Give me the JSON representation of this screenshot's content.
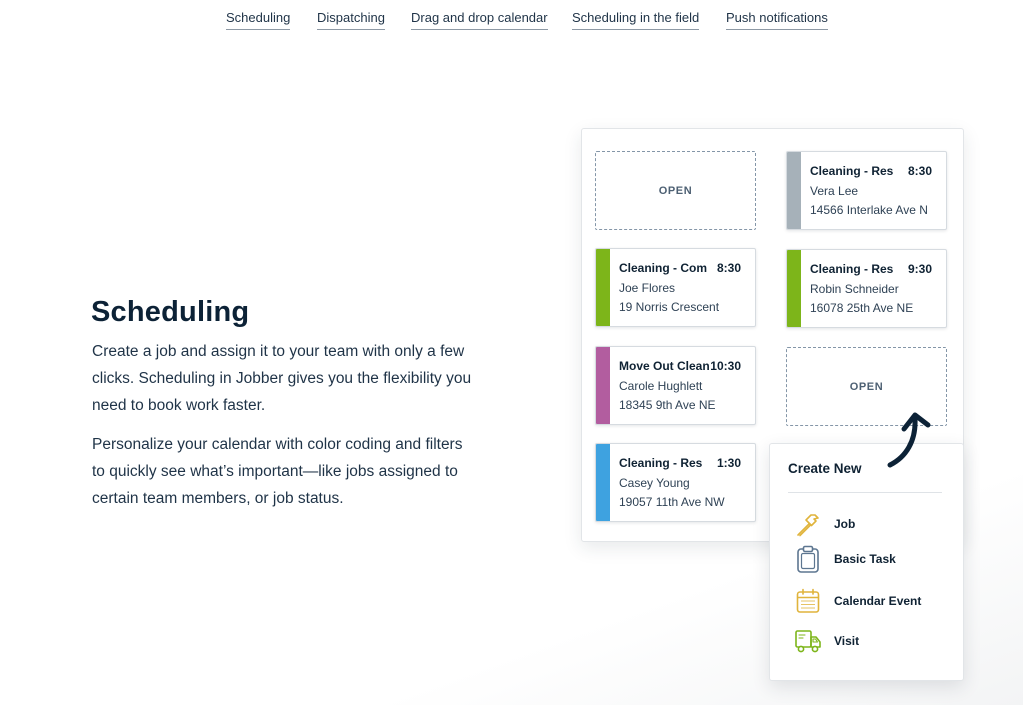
{
  "nav": {
    "links": [
      {
        "label": "Scheduling"
      },
      {
        "label": "Dispatching"
      },
      {
        "label": "Drag and drop calendar"
      },
      {
        "label": "Scheduling in the field"
      },
      {
        "label": "Push notifications"
      }
    ]
  },
  "main": {
    "heading": "Scheduling",
    "paragraphs": [
      "Create a job and assign it to your team with only a few clicks. Scheduling in Jobber gives you the flexibility you need to book work faster.",
      "Personalize your calendar with color coding and filters to quickly see what’s important—like jobs assigned to certain team members, or job status."
    ]
  },
  "calendar": {
    "open_label_1": "OPEN",
    "open_label_2": "OPEN",
    "jobs": [
      {
        "title": "Cleaning - Res",
        "time": "8:30",
        "name": "Vera Lee",
        "address": "14566 Interlake Ave N",
        "color": "#a6b1b9"
      },
      {
        "title": "Cleaning - Com",
        "time": "8:30",
        "name": "Joe Flores",
        "address": "19 Norris Crescent",
        "color": "#7db51a"
      },
      {
        "title": "Cleaning - Res",
        "time": "9:30",
        "name": "Robin Schneider",
        "address": "16078 25th Ave NE",
        "color": "#7db51a"
      },
      {
        "title": "Move Out Clean",
        "time": "10:30",
        "name": "Carole Hughlett",
        "address": "18345 9th Ave NE",
        "color": "#b25d9f"
      },
      {
        "title": "Cleaning - Res",
        "time": "1:30",
        "name": "Casey Young",
        "address": "19057 11th Ave NW",
        "color": "#3ea2e0"
      }
    ]
  },
  "create_menu": {
    "title": "Create New",
    "items": [
      {
        "label": "Job",
        "icon": "hammer-icon",
        "color": "#e0b43c"
      },
      {
        "label": "Basic Task",
        "icon": "clipboard-icon",
        "color": "#5d7690"
      },
      {
        "label": "Calendar Event",
        "icon": "calendar-icon",
        "color": "#e0b43c"
      },
      {
        "label": "Visit",
        "icon": "truck-icon",
        "color": "#7db51a"
      }
    ]
  },
  "colors": {
    "heading": "#0c2236",
    "text": "#1f3347",
    "arrow": "#0c2236"
  }
}
